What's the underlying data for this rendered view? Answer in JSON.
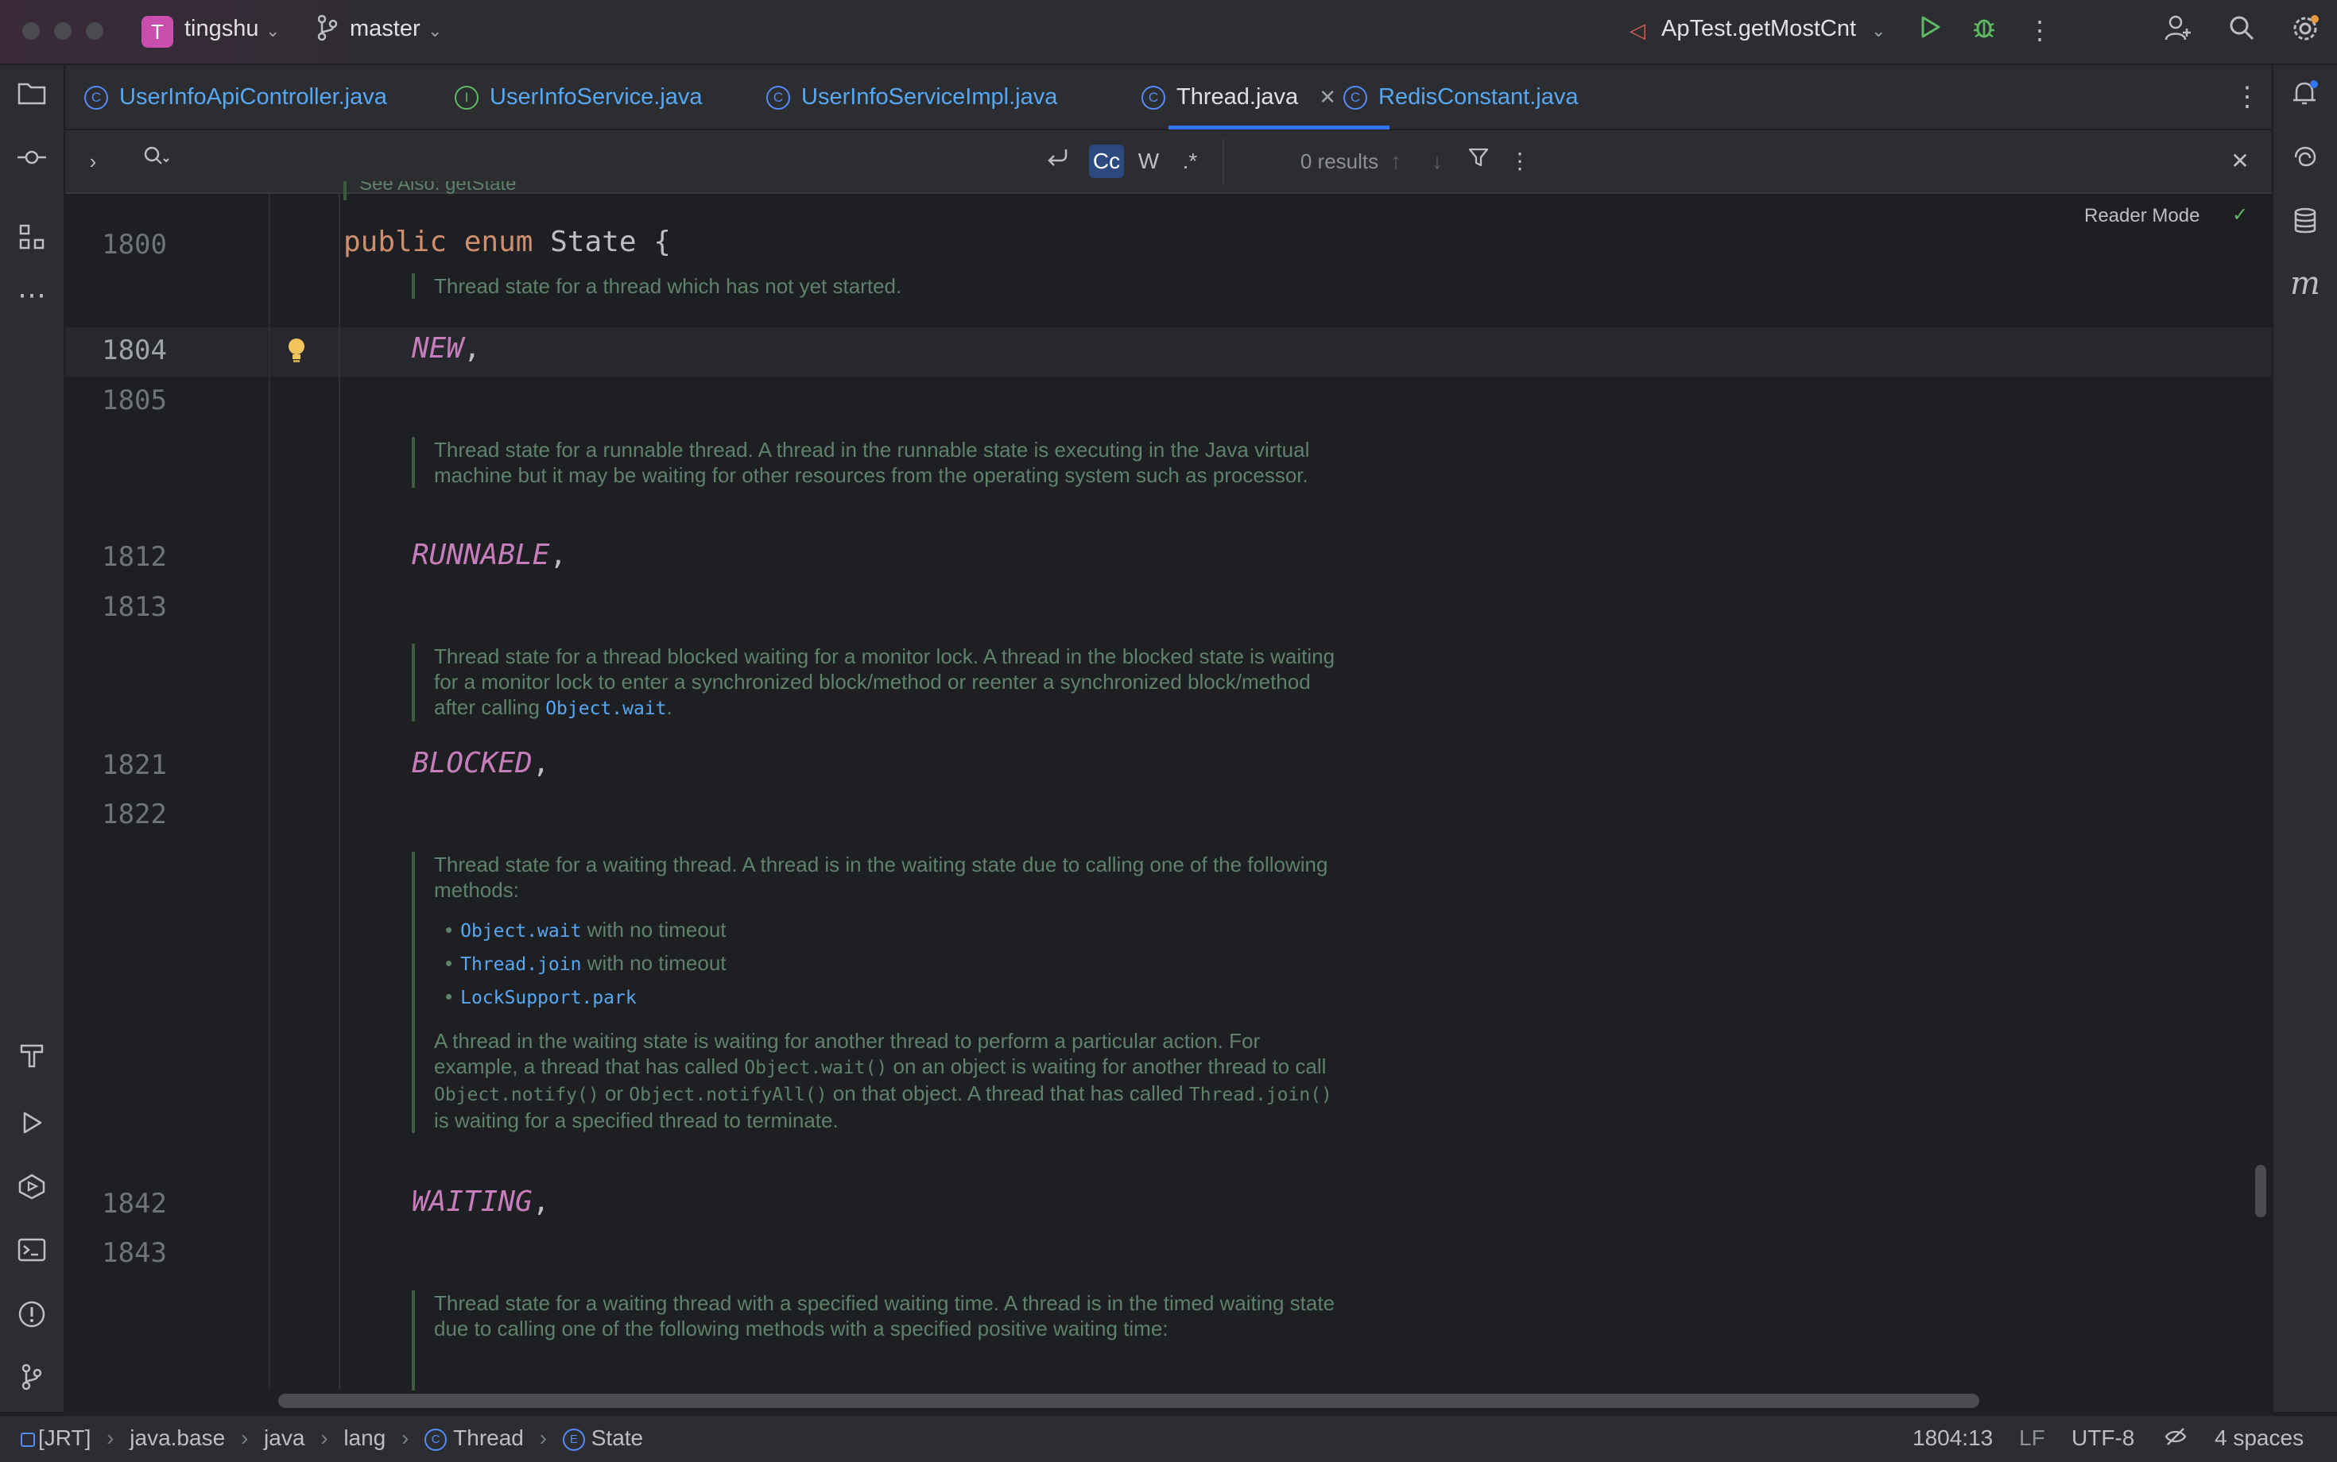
{
  "titlebar": {
    "project_initial": "T",
    "project_name": "tingshu",
    "branch": "master",
    "run_config": "ApTest.getMostCnt"
  },
  "tabs": [
    {
      "label": "UserInfoApiController.java",
      "icon": "class-icon"
    },
    {
      "label": "UserInfoService.java",
      "icon": "interface-icon"
    },
    {
      "label": "UserInfoServiceImpl.java",
      "icon": "class-icon"
    },
    {
      "label": "Thread.java",
      "icon": "class-icon",
      "active": true
    },
    {
      "label": "RedisConstant.java",
      "icon": "class-icon"
    }
  ],
  "findbar": {
    "case_label": "Cc",
    "word_label": "W",
    "regex_label": ".*",
    "results": "0 results"
  },
  "editor": {
    "reader_mode": "Reader Mode",
    "cut_top_text": "See Also: getState",
    "lines": {
      "l1800": "1800",
      "l1804": "1804",
      "l1805": "1805",
      "l1812": "1812",
      "l1813": "1813",
      "l1821": "1821",
      "l1822": "1822",
      "l1842": "1842",
      "l1843": "1843"
    },
    "code": {
      "kw_public": "public",
      "kw_enum": "enum",
      "enum_name": "State",
      "brace": "{",
      "new": "NEW",
      "runnable": "RUNNABLE",
      "blocked": "BLOCKED",
      "waiting": "WAITING",
      "comma": ","
    },
    "docs": {
      "new": "Thread state for a thread which has not yet started.",
      "runnable": "Thread state for a runnable thread. A thread in the runnable state is executing in the Java virtual machine but it may be waiting for other resources from the operating system such as processor.",
      "blocked_pre": "Thread state for a thread blocked waiting for a monitor lock. A thread in the blocked state is waiting for a monitor lock to enter a synchronized block/method or reenter a synchronized block/method after calling ",
      "blocked_link": "Object.wait",
      "blocked_post": ".",
      "waiting_intro": "Thread state for a waiting thread. A thread is in the waiting state due to calling one of the following methods:",
      "waiting_items": [
        {
          "code": "Object.wait",
          "text": " with no timeout"
        },
        {
          "code": "Thread.join",
          "text": " with no timeout"
        },
        {
          "code": "LockSupport.park",
          "text": ""
        }
      ],
      "waiting_p1": "A thread in the waiting state is waiting for another thread to perform a particular action. For example, a thread that has called ",
      "waiting_c1": "Object.wait()",
      "waiting_p2": " on an object is waiting for another thread to call ",
      "waiting_c2": "Object.notify()",
      "waiting_p3": " or ",
      "waiting_c3": "Object.notifyAll()",
      "waiting_p4": " on that object. A thread that has called ",
      "waiting_c4": "Thread.join()",
      "waiting_p5": " is waiting for a specified thread to terminate.",
      "timed": "Thread state for a waiting thread with a specified waiting time. A thread is in the timed waiting state due to calling one of the following methods with a specified positive waiting time:"
    }
  },
  "statusbar": {
    "crumbs": [
      "[JRT]",
      "java.base",
      "java",
      "lang",
      "Thread",
      "State"
    ],
    "position": "1804:13",
    "line_sep": "LF",
    "encoding": "UTF-8",
    "indent": "4 spaces"
  },
  "colors": {
    "accent": "#3574f0",
    "keyword": "#cf8e6d",
    "enum_constant": "#c77dbb",
    "doc_text": "#5f826b",
    "doc_link": "#56a8f5"
  }
}
